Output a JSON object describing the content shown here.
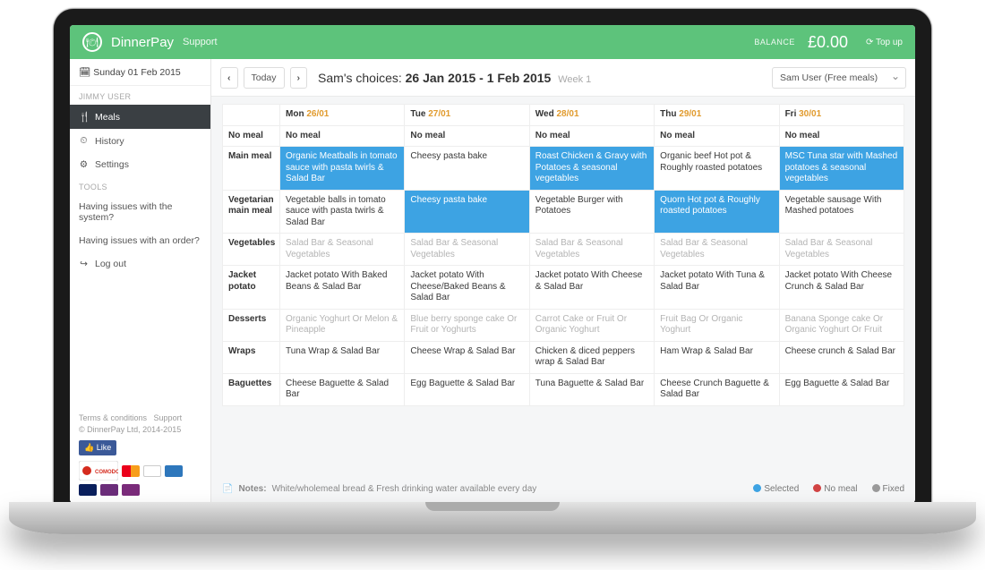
{
  "brand": "DinnerPay",
  "topbar": {
    "support": "Support",
    "balance_label": "BALANCE",
    "balance_amount": "£0.00",
    "topup": "⟳ Top up"
  },
  "sidebar": {
    "date": "Sunday 01 Feb 2015",
    "user_group": "JIMMY USER",
    "items": [
      {
        "icon": "🍴",
        "label": "Meals",
        "active": true
      },
      {
        "icon": "⏲",
        "label": "History",
        "active": false
      },
      {
        "icon": "⚙",
        "label": "Settings",
        "active": false
      }
    ],
    "tools_label": "TOOLS",
    "tools": [
      {
        "label": "Having issues with the system?"
      },
      {
        "label": "Having issues with an order?"
      }
    ],
    "logout": "Log out",
    "footer_terms": "Terms & conditions",
    "footer_support": "Support",
    "copyright": "© DinnerPay Ltd, 2014-2015",
    "like": "👍 Like"
  },
  "toolbar": {
    "today": "Today",
    "title_prefix": "Sam's choices:",
    "title_range": "26 Jan 2015 - 1 Feb 2015",
    "title_week": "Week 1",
    "select_value": "Sam User (Free meals)"
  },
  "days": [
    {
      "name": "Mon",
      "num": "26/01"
    },
    {
      "name": "Tue",
      "num": "27/01"
    },
    {
      "name": "Wed",
      "num": "28/01"
    },
    {
      "name": "Thu",
      "num": "29/01"
    },
    {
      "name": "Fri",
      "num": "30/01"
    }
  ],
  "rows": [
    {
      "key": "nomeal",
      "label": "No meal",
      "cells": [
        {
          "text": "No meal"
        },
        {
          "text": "No meal"
        },
        {
          "text": "No meal"
        },
        {
          "text": "No meal"
        },
        {
          "text": "No meal"
        }
      ]
    },
    {
      "key": "mainmeal",
      "label": "Main meal",
      "cells": [
        {
          "text": "Organic Meatballs in tomato sauce with pasta twirls & Salad Bar",
          "sel": true
        },
        {
          "text": "Cheesy pasta bake"
        },
        {
          "text": "Roast Chicken & Gravy with Potatoes & seasonal vegetables",
          "sel": true
        },
        {
          "text": "Organic beef Hot pot & Roughly roasted potatoes"
        },
        {
          "text": "MSC Tuna star with Mashed potatoes & seasonal vegetables",
          "sel": true
        }
      ]
    },
    {
      "key": "veg",
      "label": "Vegetarian main meal",
      "cells": [
        {
          "text": "Vegetable balls in tomato sauce with pasta twirls & Salad Bar"
        },
        {
          "text": "Cheesy pasta bake",
          "sel": true
        },
        {
          "text": "Vegetable Burger with Potatoes"
        },
        {
          "text": "Quorn Hot pot & Roughly roasted potatoes",
          "sel": true
        },
        {
          "text": "Vegetable sausage With Mashed potatoes"
        }
      ]
    },
    {
      "key": "vegetables",
      "label": "Vegetables",
      "cells": [
        {
          "text": "Salad Bar & Seasonal Vegetables",
          "muted": true
        },
        {
          "text": "Salad Bar & Seasonal Vegetables",
          "muted": true
        },
        {
          "text": "Salad Bar & Seasonal Vegetables",
          "muted": true
        },
        {
          "text": "Salad Bar & Seasonal Vegetables",
          "muted": true
        },
        {
          "text": "Salad Bar & Seasonal Vegetables",
          "muted": true
        }
      ]
    },
    {
      "key": "jacket",
      "label": "Jacket potato",
      "cells": [
        {
          "text": "Jacket potato With Baked Beans & Salad Bar"
        },
        {
          "text": "Jacket potato With Cheese/Baked Beans & Salad Bar"
        },
        {
          "text": "Jacket potato With Cheese & Salad Bar"
        },
        {
          "text": "Jacket potato With Tuna & Salad Bar"
        },
        {
          "text": "Jacket potato With Cheese Crunch & Salad Bar"
        }
      ]
    },
    {
      "key": "desserts",
      "label": "Desserts",
      "cells": [
        {
          "text": "Organic Yoghurt Or Melon & Pineapple",
          "muted": true
        },
        {
          "text": "Blue berry sponge cake Or Fruit or Yoghurts",
          "muted": true
        },
        {
          "text": "Carrot Cake or Fruit Or Organic Yoghurt",
          "muted": true
        },
        {
          "text": "Fruit Bag Or Organic Yoghurt",
          "muted": true
        },
        {
          "text": "Banana Sponge cake Or Organic Yoghurt Or Fruit",
          "muted": true
        }
      ]
    },
    {
      "key": "wraps",
      "label": "Wraps",
      "cells": [
        {
          "text": "Tuna Wrap & Salad Bar"
        },
        {
          "text": "Cheese Wrap & Salad Bar"
        },
        {
          "text": "Chicken & diced peppers wrap & Salad Bar"
        },
        {
          "text": "Ham Wrap & Salad Bar"
        },
        {
          "text": "Cheese crunch & Salad Bar"
        }
      ]
    },
    {
      "key": "baguettes",
      "label": "Baguettes",
      "cells": [
        {
          "text": "Cheese Baguette & Salad Bar"
        },
        {
          "text": "Egg Baguette & Salad Bar"
        },
        {
          "text": "Tuna Baguette & Salad Bar"
        },
        {
          "text": "Cheese Crunch Baguette & Salad Bar"
        },
        {
          "text": "Egg Baguette & Salad Bar"
        }
      ]
    }
  ],
  "notes": {
    "label": "Notes:",
    "text": "White/wholemeal bread & Fresh drinking water available every day"
  },
  "legend": {
    "selected": "Selected",
    "nomeal": "No meal",
    "fixed": "Fixed"
  }
}
